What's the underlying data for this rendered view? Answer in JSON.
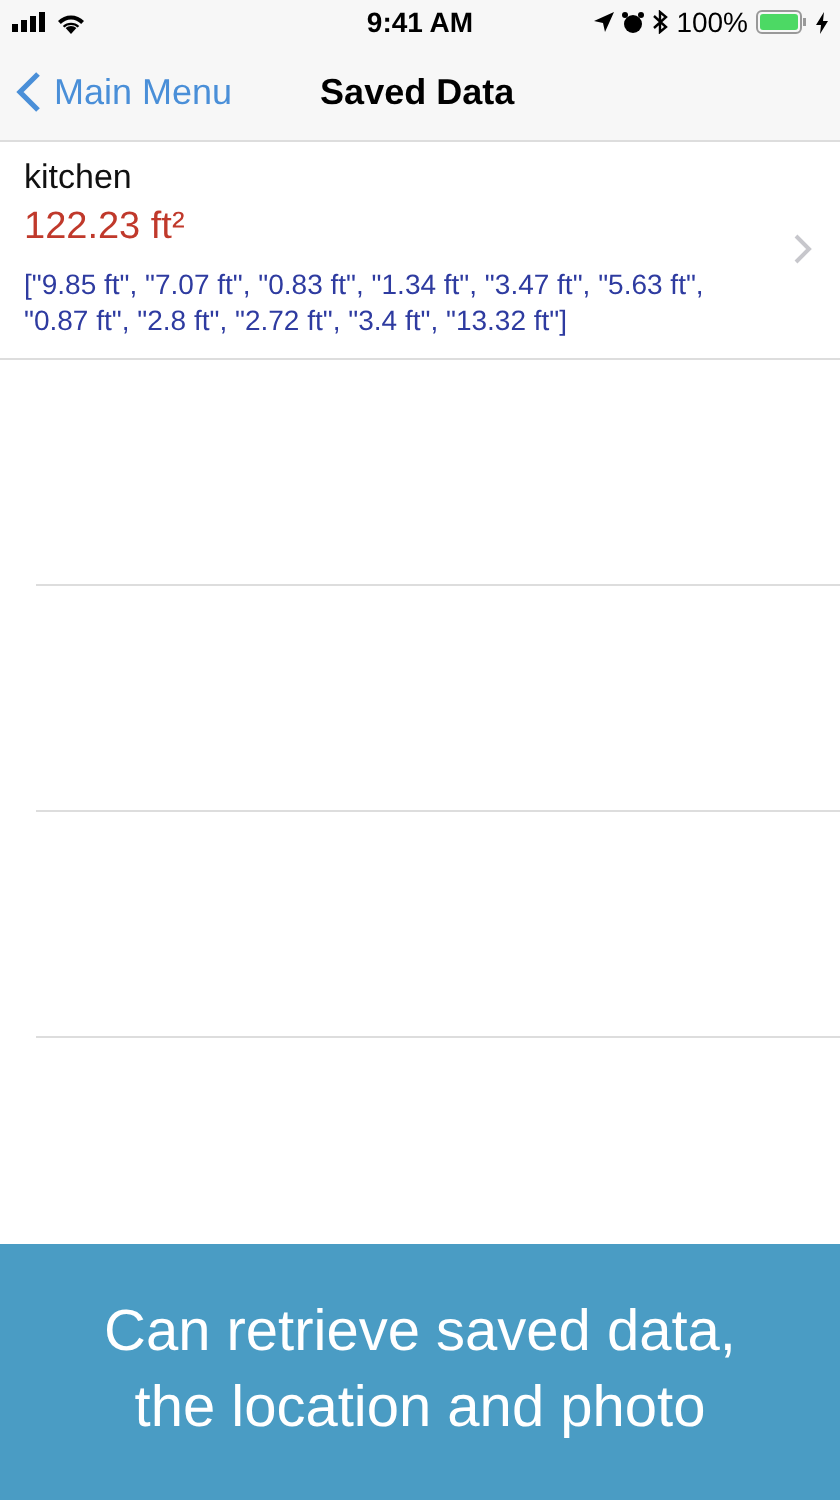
{
  "status_bar": {
    "time": "9:41 AM",
    "battery": "100%"
  },
  "nav": {
    "back": "Main Menu",
    "title": "Saved Data"
  },
  "rows": [
    {
      "name": "kitchen",
      "area": "122.23 ft²",
      "measurements": "[\"9.85 ft\", \"7.07 ft\", \"0.83 ft\", \"1.34 ft\", \"3.47 ft\", \"5.63 ft\", \"0.87 ft\", \"2.8 ft\", \"2.72 ft\", \"3.4 ft\", \"13.32 ft\"]"
    }
  ],
  "banner": {
    "lines": [
      "Can retrieve saved data,",
      "the location and photo"
    ]
  }
}
